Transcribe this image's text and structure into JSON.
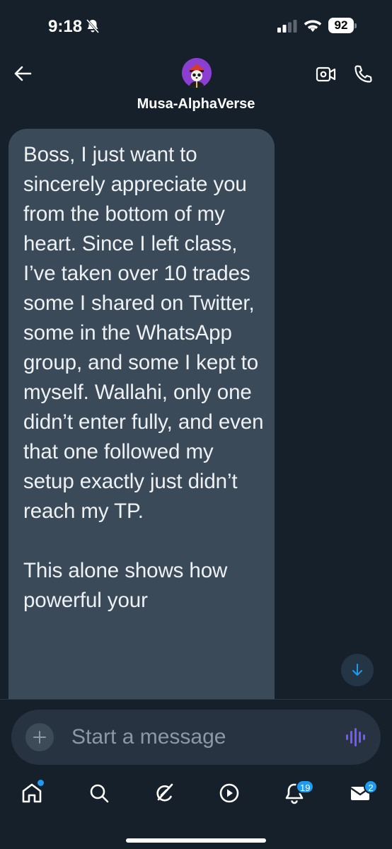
{
  "status_bar": {
    "time": "9:18",
    "battery": "92"
  },
  "header": {
    "contact_name": "Musa-AlphaVerse"
  },
  "message": {
    "text": "Boss, I just want to sincerely appreciate you from the bottom of my heart. Since I left class, I’ve taken over 10 trades  some I shared on Twitter, some in the WhatsApp group, and some I kept to myself. Wallahi, only one didn’t enter fully, and even that one followed my setup exactly just didn’t reach my TP.\n\nThis alone shows how powerful your"
  },
  "composer": {
    "placeholder": "Start a message"
  },
  "tabbar": {
    "notifications_badge": "19",
    "messages_badge": "2"
  },
  "colors": {
    "background": "#15202b",
    "bubble": "#3b4a58",
    "accent": "#1d9bf0",
    "voice": "#7856ff"
  },
  "icons": [
    "bell-off-icon",
    "signal-icon",
    "wifi-icon",
    "back-arrow-icon",
    "video-call-icon",
    "phone-icon",
    "arrow-down-icon",
    "plus-icon",
    "voice-wave-icon",
    "home-icon",
    "search-icon",
    "grok-icon",
    "play-icon",
    "bell-icon",
    "mail-icon"
  ]
}
